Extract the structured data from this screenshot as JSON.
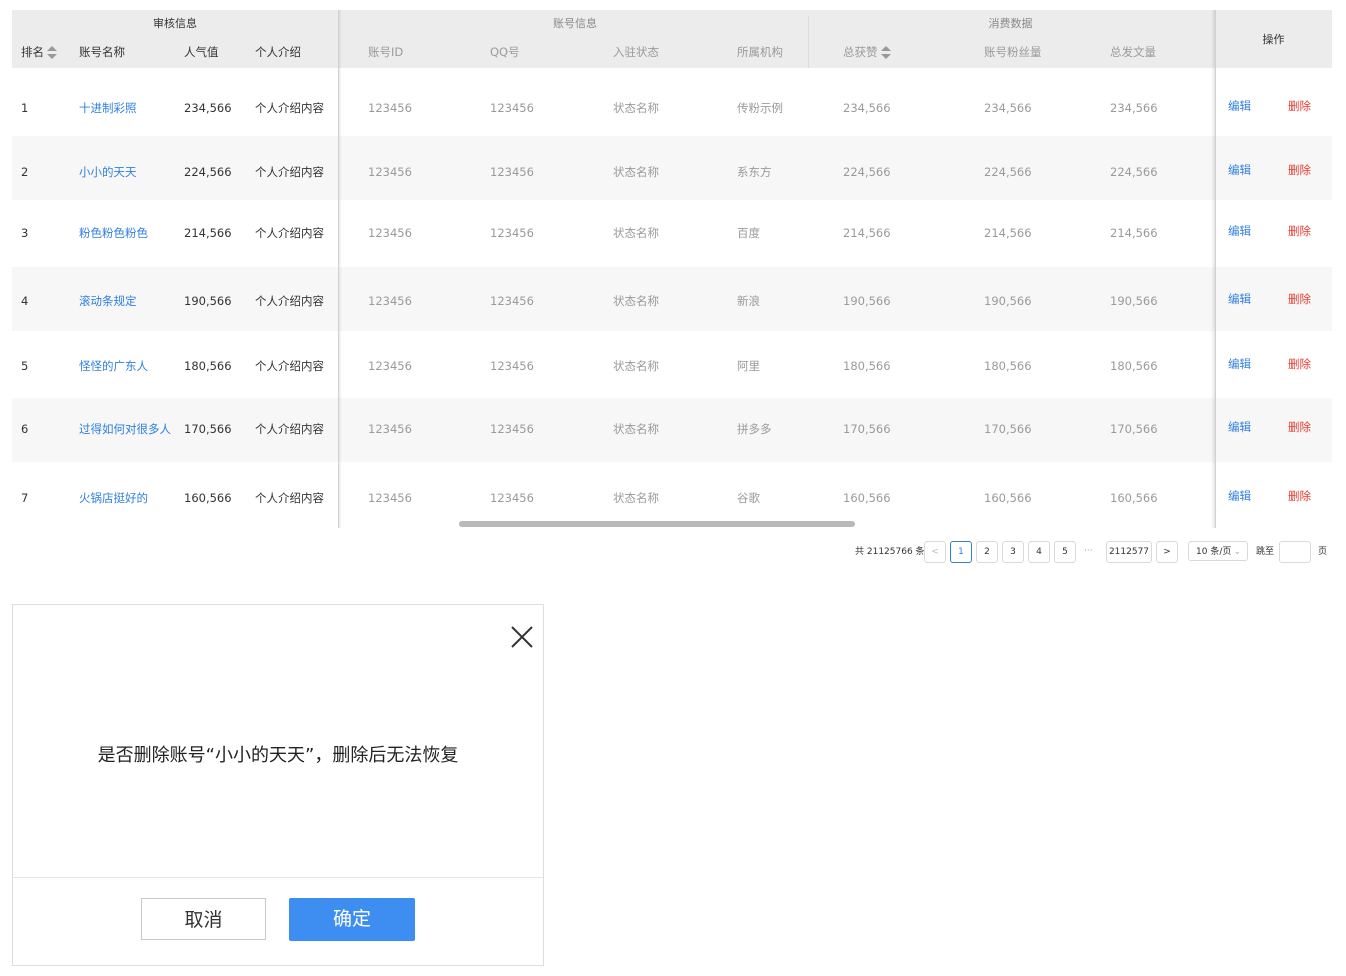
{
  "table": {
    "groups": {
      "review": "审核信息",
      "account": "账号信息",
      "consume": "消费数据",
      "ops": "操作"
    },
    "columns": {
      "rank": "排名",
      "name": "账号名称",
      "popularity": "人气值",
      "intro": "个人介绍",
      "account_id": "账号ID",
      "qq": "QQ号",
      "status": "入驻状态",
      "org": "所属机构",
      "likes": "总获赞",
      "fans": "账号粉丝量",
      "posts": "总发文量"
    },
    "rows": [
      {
        "rank": "1",
        "name": "十进制彩照",
        "popularity": "234,566",
        "intro": "个人介绍内容",
        "account_id": "123456",
        "qq": "123456",
        "status": "状态名称",
        "org": "传粉示例",
        "likes": "234,566",
        "fans": "234,566",
        "posts": "234,566",
        "edit": "编辑",
        "delete": "删除"
      },
      {
        "rank": "2",
        "name": "小小的天天",
        "popularity": "224,566",
        "intro": "个人介绍内容",
        "account_id": "123456",
        "qq": "123456",
        "status": "状态名称",
        "org": "系东方",
        "likes": "224,566",
        "fans": "224,566",
        "posts": "224,566",
        "edit": "编辑",
        "delete": "删除"
      },
      {
        "rank": "3",
        "name": "粉色粉色粉色",
        "popularity": "214,566",
        "intro": "个人介绍内容",
        "account_id": "123456",
        "qq": "123456",
        "status": "状态名称",
        "org": "百度",
        "likes": "214,566",
        "fans": "214,566",
        "posts": "214,566",
        "edit": "编辑",
        "delete": "删除"
      },
      {
        "rank": "4",
        "name": "滚动条规定",
        "popularity": "190,566",
        "intro": "个人介绍内容",
        "account_id": "123456",
        "qq": "123456",
        "status": "状态名称",
        "org": "新浪",
        "likes": "190,566",
        "fans": "190,566",
        "posts": "190,566",
        "edit": "编辑",
        "delete": "删除"
      },
      {
        "rank": "5",
        "name": "怪怪的广东人",
        "popularity": "180,566",
        "intro": "个人介绍内容",
        "account_id": "123456",
        "qq": "123456",
        "status": "状态名称",
        "org": "阿里",
        "likes": "180,566",
        "fans": "180,566",
        "posts": "180,566",
        "edit": "编辑",
        "delete": "删除"
      },
      {
        "rank": "6",
        "name": "过得如何对很多人",
        "popularity": "170,566",
        "intro": "个人介绍内容",
        "account_id": "123456",
        "qq": "123456",
        "status": "状态名称",
        "org": "拼多多",
        "likes": "170,566",
        "fans": "170,566",
        "posts": "170,566",
        "edit": "编辑",
        "delete": "删除"
      },
      {
        "rank": "7",
        "name": "火锅店挺好的",
        "popularity": "160,566",
        "intro": "个人介绍内容",
        "account_id": "123456",
        "qq": "123456",
        "status": "状态名称",
        "org": "谷歌",
        "likes": "160,566",
        "fans": "160,566",
        "posts": "160,566",
        "edit": "编辑",
        "delete": "删除"
      }
    ]
  },
  "pagination": {
    "total": "共 21125766 条",
    "prev": "<",
    "pages": [
      "1",
      "2",
      "3",
      "4",
      "5"
    ],
    "ellipsis": "···",
    "last": "2112577",
    "next": ">",
    "page_size": "10 条/页",
    "jump_label": "跳至",
    "jump_suffix": "页",
    "current_page": "1"
  },
  "modal": {
    "message": "是否删除账号“小小的天天”，删除后无法恢复",
    "cancel": "取消",
    "confirm": "确定"
  },
  "colors": {
    "link": "#2f7fe0",
    "danger": "#e8392f",
    "primary": "#3d8ef0",
    "header_bg": "#ececec"
  }
}
